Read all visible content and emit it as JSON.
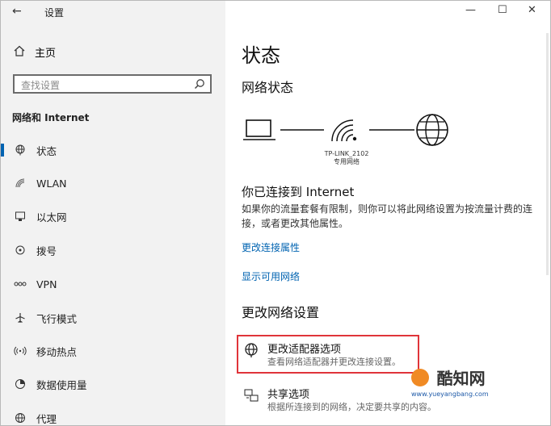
{
  "window": {
    "title": "设置",
    "back_glyph": "←",
    "min_glyph": "—",
    "max_glyph": "☐",
    "close_glyph": "✕"
  },
  "sidebar": {
    "home_label": "主页",
    "search_placeholder": "查找设置",
    "section_title": "网络和 Internet",
    "items": [
      {
        "label": "状态",
        "icon": "status-globe-icon",
        "selected": true
      },
      {
        "label": "WLAN",
        "icon": "wifi-icon"
      },
      {
        "label": "以太网",
        "icon": "ethernet-icon"
      },
      {
        "label": "拨号",
        "icon": "dialup-icon"
      },
      {
        "label": "VPN",
        "icon": "vpn-icon"
      },
      {
        "label": "飞行模式",
        "icon": "airplane-icon"
      },
      {
        "label": "移动热点",
        "icon": "hotspot-icon"
      },
      {
        "label": "数据使用量",
        "icon": "data-usage-icon"
      },
      {
        "label": "代理",
        "icon": "proxy-globe-icon"
      }
    ]
  },
  "main": {
    "title": "状态",
    "network_status_heading": "网络状态",
    "network_name": "TP-LINK_2102",
    "network_type": "专用网络",
    "connected_heading": "你已连接到 Internet",
    "connected_desc": "如果你的流量套餐有限制，则你可以将此网络设置为按流量计费的连接，或者更改其他属性。",
    "link_change_props": "更改连接属性",
    "link_show_networks": "显示可用网络",
    "change_settings_heading": "更改网络设置",
    "options": [
      {
        "title": "更改适配器选项",
        "desc": "查看网络适配器并更改连接设置。",
        "icon": "adapter-globe-icon",
        "highlighted": true
      },
      {
        "title": "共享选项",
        "desc": "根据所连接到的网络，决定要共享的内容。",
        "icon": "sharing-icon"
      }
    ]
  },
  "watermark": {
    "text": "酷知网",
    "subtext": "www.yueyangbang.com"
  },
  "colors": {
    "accent": "#0063b1",
    "highlight_border": "#e0343a",
    "sidebar_bg": "#f2f2f2"
  }
}
